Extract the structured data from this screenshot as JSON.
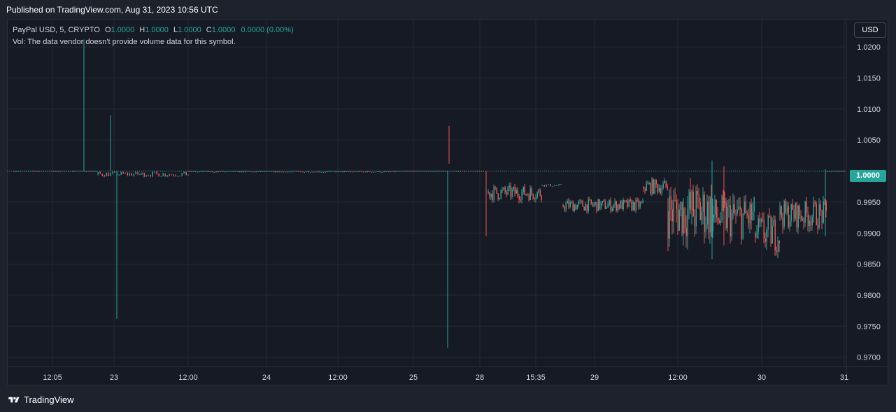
{
  "header": {
    "published": "Published on TradingView.com, Aug 31, 2023 10:56 UTC"
  },
  "legend": {
    "symbol": "PayPal USD, 5, CRYPTO",
    "o_label": "O",
    "o_value": "1.0000",
    "h_label": "H",
    "h_value": "1.0000",
    "l_label": "L",
    "l_value": "1.0000",
    "c_label": "C",
    "c_value": "1.0000",
    "change": "0.0000 (0.00%)",
    "vol_note": "Vol: The data vendor doesn't provide volume data for this symbol."
  },
  "currency_button": "USD",
  "last_price": "1.0000",
  "footer": {
    "brand": "TradingView"
  },
  "colors": {
    "up": "#26a69a",
    "down": "#ef5350",
    "background": "#161a25",
    "grid": "#242833"
  },
  "icons": [
    "tradingview-logo-icon"
  ],
  "chart_data": {
    "type": "candlestick",
    "interval": "5",
    "currency": "USD",
    "y_ticks": [
      "1.0200",
      "1.0150",
      "1.0100",
      "1.0050",
      "1.0000",
      "0.9950",
      "0.9900",
      "0.9850",
      "0.9800",
      "0.9750",
      "0.9700"
    ],
    "ylim": [
      0.9685,
      1.0225
    ],
    "x_ticks": [
      "12:05",
      "23",
      "12:00",
      "24",
      "12:00",
      "25",
      "28",
      "15:35",
      "29",
      "12:00",
      "30",
      "31"
    ],
    "grid": true,
    "segments": [
      {
        "from": 0.0,
        "to": 0.085,
        "base": 1.0,
        "noise": 3e-05
      },
      {
        "from": 0.085,
        "to": 0.12,
        "base": 1.0,
        "noise": 4e-05
      },
      {
        "from": 0.12,
        "to": 0.25,
        "base": 0.9995,
        "noise": 0.0004
      },
      {
        "from": 0.25,
        "to": 0.55,
        "base": 0.9999,
        "noise": 0.0001
      },
      {
        "from": 0.55,
        "to": 0.62,
        "base": 1.0,
        "noise": 4e-05
      },
      {
        "from": 0.62,
        "to": 0.675,
        "base": 1.0,
        "noise": 3e-05
      },
      {
        "from": 0.678,
        "to": 0.755,
        "base": 0.9965,
        "noise": 0.0012
      },
      {
        "from": 0.755,
        "to": 0.785,
        "base": 0.9977,
        "noise": 0.0002
      },
      {
        "from": 0.785,
        "to": 0.9,
        "base": 0.9945,
        "noise": 0.001
      },
      {
        "from": 0.9,
        "to": 0.935,
        "base": 0.9975,
        "noise": 0.0012
      },
      {
        "from": 0.935,
        "to": 1.0,
        "base": 0.9935,
        "noise": 0.0045
      },
      {
        "from": 1.0,
        "to": 1.06,
        "base": 0.9925,
        "noise": 0.0035
      },
      {
        "from": 1.06,
        "to": 1.095,
        "base": 0.99,
        "noise": 0.003
      },
      {
        "from": 1.095,
        "to": 1.162,
        "base": 0.993,
        "noise": 0.0022
      },
      {
        "from": 1.162,
        "to": 1.19,
        "base": 1.0,
        "noise": 3e-05
      }
    ],
    "spikes": [
      {
        "pos": 0.1,
        "high": 1.0212,
        "low": 1.0,
        "color": "up"
      },
      {
        "pos": 0.138,
        "high": 1.009,
        "low": 1.0,
        "color": "up"
      },
      {
        "pos": 0.147,
        "high": 1.0,
        "low": 0.9762,
        "color": "up"
      },
      {
        "pos": 0.622,
        "high": 1.0073,
        "low": 1.0012,
        "color": "down"
      },
      {
        "pos": 0.62,
        "high": 1.0,
        "low": 0.9715,
        "color": "up"
      },
      {
        "pos": 0.675,
        "high": 1.0,
        "low": 0.9895,
        "color": "down"
      },
      {
        "pos": 0.998,
        "high": 1.0017,
        "low": 0.9858,
        "color": "up"
      },
      {
        "pos": 1.015,
        "high": 1.0008,
        "low": 0.988,
        "color": "down"
      },
      {
        "pos": 1.16,
        "high": 1.0003,
        "low": 0.9895,
        "color": "up"
      }
    ]
  }
}
